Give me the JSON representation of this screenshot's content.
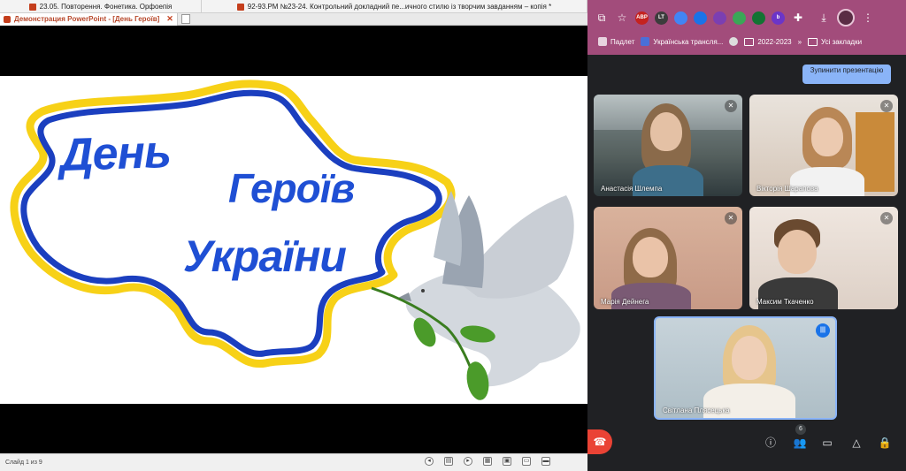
{
  "ppt": {
    "tabs": [
      "23.05. Повторення. Фонетика. Орфоепія",
      "92-93.РМ №23-24. Контрольний докладний пе...ичного стилю із творчим завданням – копія *"
    ],
    "window_title": "Демонстрация PowerPoint - [День Героїв]",
    "slide": {
      "line1": "День",
      "line2": "Героїв",
      "line3": "України"
    },
    "status": "Слайд 1 из 9"
  },
  "chrome": {
    "bookmarks": [
      "Падлет",
      "Українська трансля...",
      "2022-2023",
      "Усі закладки"
    ],
    "extensions": [
      {
        "label": "ABP",
        "color": "#c5221f"
      },
      {
        "label": "LT",
        "color": "#3c3c3c"
      },
      {
        "label": "",
        "color": "#4285f4"
      },
      {
        "label": "",
        "color": "#1a73e8"
      },
      {
        "label": "",
        "color": "#7b3fb2"
      },
      {
        "label": "",
        "color": "#3aa757"
      },
      {
        "label": "",
        "color": "#137333"
      },
      {
        "label": "b",
        "color": "#6b35c8"
      },
      {
        "label": "",
        "color": "#9e9e9e"
      }
    ]
  },
  "meet": {
    "stop_presentation": "Зупинити презентацію",
    "participants": [
      "Анастасія Шлемпа",
      "Вікторія Шарапова",
      "Марія Дейнега",
      "Максим Ткаченко",
      "Світлана Плясецька"
    ],
    "participant_count": "6"
  },
  "colors": {
    "ukraine_blue": "#1f4fd4",
    "ukraine_yellow": "#f7d117",
    "chrome_frame": "#a24c7b",
    "meet_bg": "#202124",
    "end_call": "#ea4335"
  }
}
